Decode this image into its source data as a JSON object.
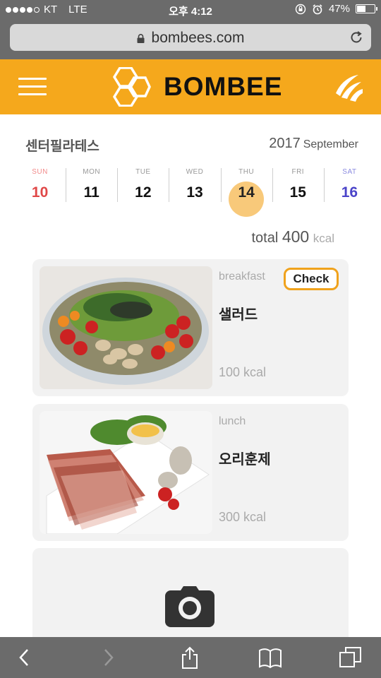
{
  "status_bar": {
    "carrier": "KT",
    "network": "LTE",
    "time": "오후 4:12",
    "battery": "47%",
    "battery_level": 0.47,
    "signal_bars": 4
  },
  "browser": {
    "url": "bombees.com"
  },
  "header": {
    "brand": "BOMBEE",
    "brand_color": "#f5a81c"
  },
  "calendar": {
    "center_name": "센터필라테스",
    "year": "2017",
    "month": "September",
    "days": [
      {
        "name": "SUN",
        "num": "10"
      },
      {
        "name": "MON",
        "num": "11"
      },
      {
        "name": "TUE",
        "num": "12"
      },
      {
        "name": "WED",
        "num": "13"
      },
      {
        "name": "THU",
        "num": "14"
      },
      {
        "name": "FRI",
        "num": "15"
      },
      {
        "name": "SAT",
        "num": "16"
      }
    ],
    "selected_day": "14"
  },
  "summary": {
    "label": "total",
    "value": "400",
    "unit": "kcal"
  },
  "meals": [
    {
      "type": "breakfast",
      "name": "샐러드",
      "kcal": "100 kcal",
      "check_label": "Check"
    },
    {
      "type": "lunch",
      "name": "오리훈제",
      "kcal": "300 kcal"
    }
  ],
  "add_meal": {
    "icon": "camera-icon"
  }
}
